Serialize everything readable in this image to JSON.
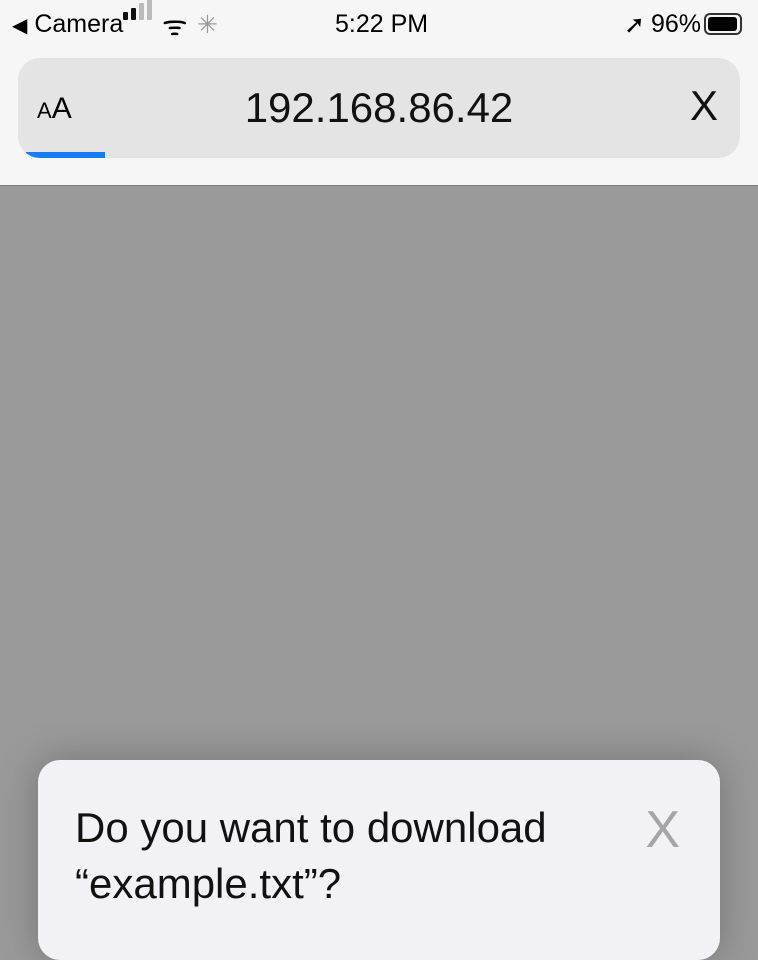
{
  "status_bar": {
    "back_app": "Camera",
    "back_icon": "◀",
    "time": "5:22 PM",
    "battery": "96%",
    "battery_level": 0.96,
    "location_icon": "location-arrow",
    "wifi_icon": "wifi",
    "loading_icon": "spinner",
    "signal_bars": 2
  },
  "address_bar": {
    "text_size_button": "AA",
    "url": "192.168.86.42",
    "stop_label": "X",
    "load_progress": 0.11,
    "progress_color": "#1a7cf5"
  },
  "download_dialog": {
    "title": "Do you want to download “example.txt”?",
    "close_label": "X"
  }
}
